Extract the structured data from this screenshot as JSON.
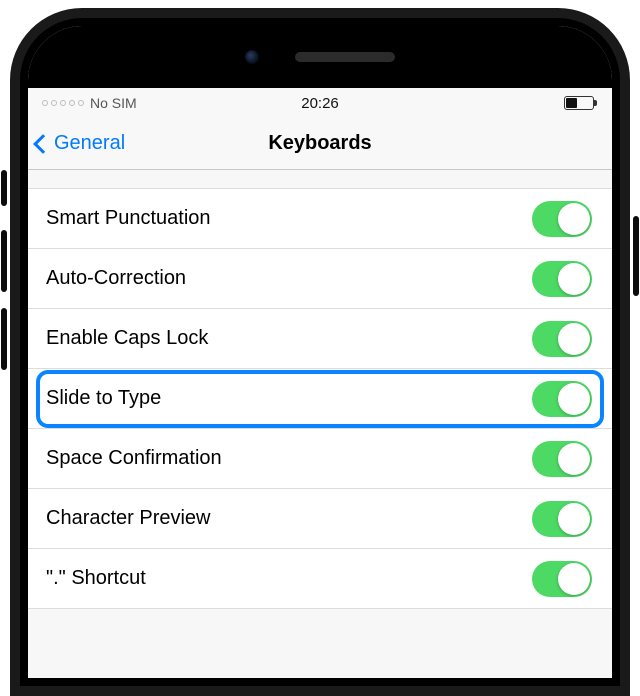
{
  "status": {
    "carrier": "No SIM",
    "time": "20:26"
  },
  "nav": {
    "back_label": "General",
    "title": "Keyboards"
  },
  "settings": [
    {
      "label": "Smart Punctuation",
      "on": true,
      "highlighted": false
    },
    {
      "label": "Auto-Correction",
      "on": true,
      "highlighted": false
    },
    {
      "label": "Enable Caps Lock",
      "on": true,
      "highlighted": false
    },
    {
      "label": "Slide to Type",
      "on": true,
      "highlighted": true
    },
    {
      "label": "Space Confirmation",
      "on": true,
      "highlighted": false
    },
    {
      "label": "Character Preview",
      "on": true,
      "highlighted": false
    },
    {
      "label": "\".\" Shortcut",
      "on": true,
      "highlighted": false
    }
  ],
  "colors": {
    "ios_blue": "#007aff",
    "ios_green": "#4cd964",
    "highlight_blue": "#0a84ff"
  }
}
